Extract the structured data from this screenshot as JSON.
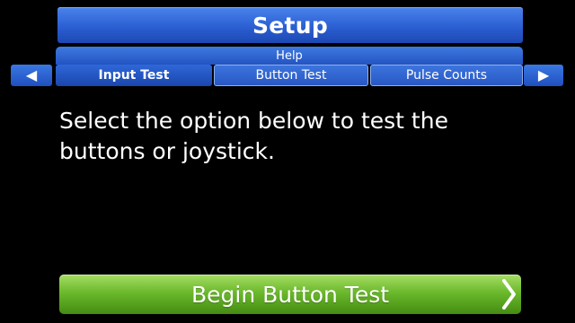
{
  "screen": {
    "title": "Setup",
    "help_label": "Help",
    "nav": {
      "left_icon": "arrow-left-icon",
      "right_icon": "arrow-right-icon"
    },
    "tabs": [
      {
        "label": "Input Test",
        "active": true
      },
      {
        "label": "Button Test",
        "active": false
      },
      {
        "label": "Pulse Counts",
        "active": false
      }
    ],
    "message": "Select the option below to test the buttons or joystick.",
    "action_button": {
      "label": "Begin Button Test",
      "icon": "chevron-right-icon"
    }
  },
  "colors": {
    "background": "#000000",
    "title_bar": "#2b5fd3",
    "tab": "#2858c4",
    "action_button": "#6bb92c",
    "text": "#ffffff"
  }
}
